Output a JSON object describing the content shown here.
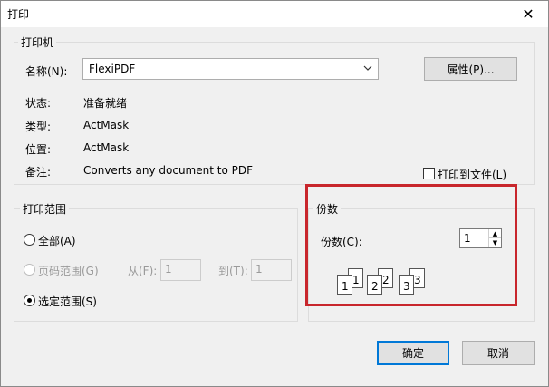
{
  "window": {
    "title": "打印",
    "close_glyph": "✕"
  },
  "printer_group": {
    "label": "打印机",
    "name_label": "名称(N):",
    "printer_value": "FlexiPDF",
    "properties_button": "属性(P)...",
    "status_label": "状态:",
    "status_value": "准备就绪",
    "type_label": "类型:",
    "type_value": "ActMask",
    "location_label": "位置:",
    "location_value": "ActMask",
    "comment_label": "备注:",
    "comment_value": "Converts any document to PDF",
    "print_to_file_label": "打印到文件(L)",
    "print_to_file_checked": false
  },
  "range_group": {
    "label": "打印范围",
    "all_label": "全部(A)",
    "pages_label": "页码范围(G)",
    "from_label": "从(F):",
    "from_value": "1",
    "to_label": "到(T):",
    "to_value": "1",
    "selection_label": "选定范围(S)",
    "selected": "selection"
  },
  "copies_group": {
    "label": "份数",
    "copies_label": "份数(C):",
    "copies_value": "1",
    "collate_pages": [
      "1",
      "1",
      "2",
      "2",
      "3",
      "3"
    ]
  },
  "buttons": {
    "ok": "确定",
    "cancel": "取消"
  },
  "highlight_color": "#c8262c",
  "accent_color": "#0078d7"
}
